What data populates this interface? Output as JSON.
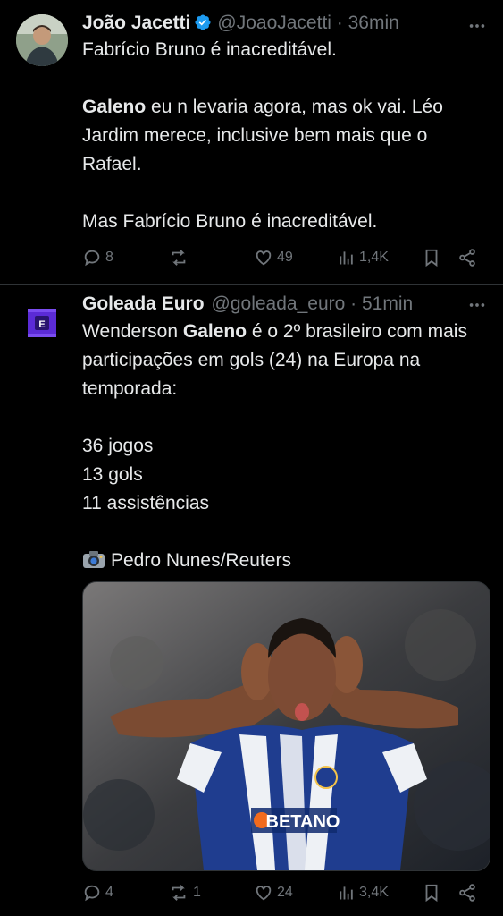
{
  "tweets": [
    {
      "name": "João Jacetti",
      "handle": "@JoaoJacetti",
      "time": "36min",
      "verified": true,
      "text": {
        "p1": "Fabrício Bruno é inacreditável.",
        "p2_bold": "Galeno",
        "p2_rest": " eu n levaria agora, mas ok vai. Léo Jardim merece, inclusive bem mais que o Rafael.",
        "p3": "Mas Fabrício Bruno é inacreditável."
      },
      "stats": {
        "replies": "8",
        "reposts": "",
        "likes": "49",
        "views": "1,4K"
      }
    },
    {
      "name": "Goleada Euro",
      "handle": "@goleada_euro",
      "time": "51min",
      "verified": false,
      "avatar_letter": "E",
      "text": {
        "p1_pre": "Wenderson ",
        "p1_bold": "Galeno",
        "p1_rest": " é o 2º brasileiro com mais participações em gols (24) na Europa na temporada:",
        "l1": "36 jogos",
        "l2": "13 gols",
        "l3": "11 assistências",
        "credit": "Pedro Nunes/Reuters"
      },
      "media": {
        "shirt_sponsor": "BETANO"
      },
      "stats": {
        "replies": "4",
        "reposts": "1",
        "likes": "24",
        "views": "3,4K"
      }
    }
  ],
  "colors": {
    "background": "#000000",
    "text": "#e7e9ea",
    "muted": "#71767b",
    "verified": "#1d9bf0",
    "avatar2": "#5b2bd6"
  }
}
